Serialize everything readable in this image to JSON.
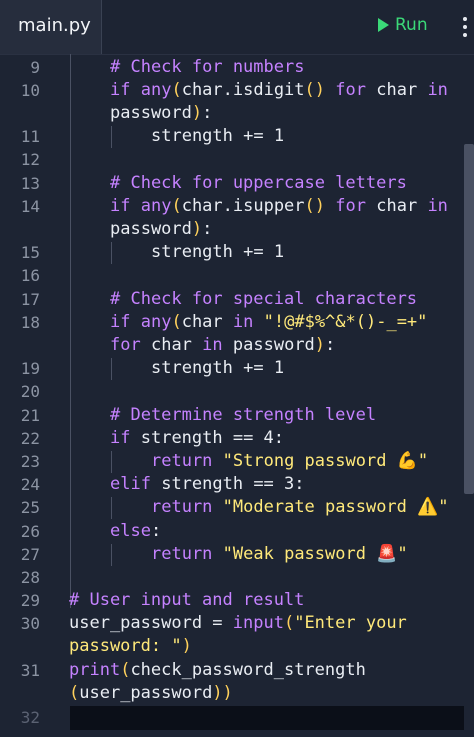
{
  "tab": {
    "filename": "main.py"
  },
  "toolbar": {
    "run_label": "Run"
  },
  "line_numbers": [
    "9",
    "10",
    "11",
    "12",
    "13",
    "14",
    "15",
    "16",
    "17",
    "18",
    "19",
    "20",
    "21",
    "22",
    "23",
    "24",
    "25",
    "26",
    "27",
    "28",
    "29",
    "30",
    "31",
    "32"
  ],
  "code": {
    "l9": "# Check for numbers",
    "l10a_kw": "if",
    "l10a_fn": "any",
    "l10a_p": "(",
    "l10a_t": "char.isdigit",
    "l10a_pp": "()",
    "l10a_for": "for",
    "l10a_c": "char",
    "l10a_in": "in",
    "l10b_t": "password",
    "l10b_p": ")",
    "l10b_c": ":",
    "l11": "strength += 1",
    "l13": "# Check for uppercase letters",
    "l14a_kw": "if",
    "l14a_fn": "any",
    "l14a_p": "(",
    "l14a_t": "char.isupper",
    "l14a_pp": "()",
    "l14a_for": "for",
    "l14a_c": "char",
    "l14a_in": "in",
    "l14b_t": "password",
    "l14b_p": ")",
    "l14b_c": ":",
    "l15": "strength += 1",
    "l17": "# Check for special characters",
    "l18a_kw": "if",
    "l18a_fn": "any",
    "l18a_p": "(",
    "l18a_c": "char",
    "l18a_in": "in",
    "l18a_s": "\"!@#$%^&*()-_=+\"",
    "l18b_for": "for",
    "l18b_c": "char",
    "l18b_in": "in",
    "l18b_t": "password",
    "l18b_p": ")",
    "l18b_col": ":",
    "l19": "strength += 1",
    "l21": "# Determine strength level",
    "l22_kw": "if",
    "l22_t": "strength == 4:",
    "l23_kw": "return",
    "l23_s": "\"Strong password 💪\"",
    "l24_kw": "elif",
    "l24_t": "strength == 3:",
    "l25_kw": "return",
    "l25_s": "\"Moderate password ⚠️\"",
    "l26_kw": "else",
    "l26_c": ":",
    "l27_kw": "return",
    "l27_s": "\"Weak password 🚨\"",
    "l29": "# User input and result",
    "l30a_t": "user_password = ",
    "l30a_fn": "input",
    "l30a_p": "(",
    "l30a_s": "\"Enter your",
    "l30b_s": "password: \"",
    "l30b_p": ")",
    "l31a_fn": "print",
    "l31a_p": "(",
    "l31a_t": "check_password_strength",
    "l31b_p": "(",
    "l31b_t": "user_password",
    "l31b_pp": "))"
  },
  "colors": {
    "background": "#1d2433",
    "keyword": "#c582ff",
    "string": "#ffe97a",
    "paren": "#ffd15c",
    "run": "#3bd978"
  },
  "icons": {
    "run": "play-icon",
    "menu": "kebab-menu-icon"
  }
}
